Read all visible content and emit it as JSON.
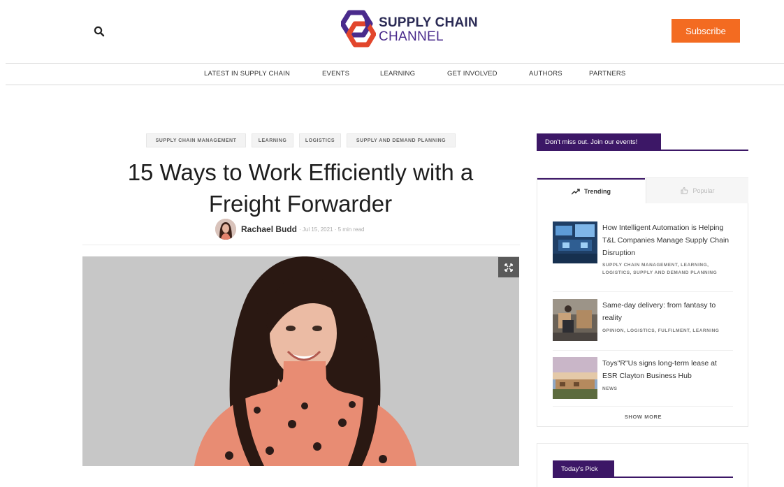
{
  "header": {
    "logo_line1": "SUPPLY CHAIN",
    "logo_line2": "CHANNEL",
    "subscribe_label": "Subscribe"
  },
  "nav": {
    "items": [
      "LATEST IN SUPPLY CHAIN",
      "EVENTS",
      "LEARNING",
      "GET INVOLVED",
      "AUTHORS",
      "PARTNERS"
    ]
  },
  "article": {
    "tags": [
      "SUPPLY CHAIN MANAGEMENT",
      "LEARNING",
      "LOGISTICS",
      "SUPPLY AND DEMAND PLANNING"
    ],
    "title": "15 Ways to Work Efficiently with a Freight Forwarder",
    "author": "Rachael Budd",
    "meta": "· Jul 15, 2021 · 5 min read"
  },
  "sidebar": {
    "events_label": "Don't miss out. Join our events!",
    "tabs": {
      "trending": "Trending",
      "popular": "Popular"
    },
    "trending": [
      {
        "title": "How Intelligent Automation is Helping T&L Companies Manage Supply Chain Disruption",
        "tags": "SUPPLY CHAIN MANAGEMENT, LEARNING, LOGISTICS, SUPPLY AND DEMAND PLANNING"
      },
      {
        "title": "Same-day delivery: from fantasy to reality",
        "tags": "OPINION, LOGISTICS, FULFILMENT, LEARNING"
      },
      {
        "title": "Toys\"R\"Us signs long-term lease at ESR Clayton Business Hub",
        "tags": "NEWS"
      }
    ],
    "show_more": "SHOW MORE",
    "todays_pick": "Today's Pick"
  },
  "colors": {
    "brand_purple": "#3c1766",
    "brand_orange": "#f36b21"
  },
  "icons": {
    "search": "search-icon",
    "expand": "expand-icon",
    "trending": "trending-icon",
    "popular": "popular-icon"
  }
}
